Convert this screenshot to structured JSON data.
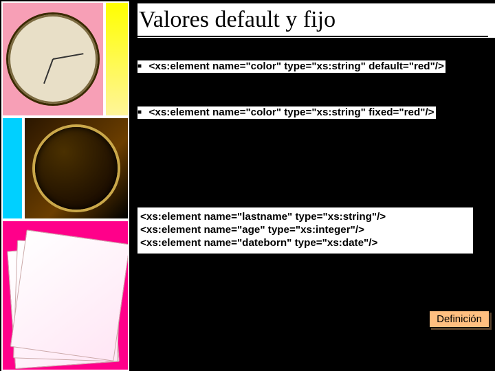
{
  "title": "Valores default y fijo",
  "code_line_default": "<xs:element name=\"color\" type=\"xs:string\" default=\"red\"/>",
  "code_line_fixed": "<xs:element name=\"color\" type=\"xs:string\" fixed=\"red\"/>",
  "code_block": {
    "line1": "<xs:element name=\"lastname\" type=\"xs:string\"/>",
    "line2": "<xs:element name=\"age\" type=\"xs:integer\"/>",
    "line3": "<xs:element name=\"dateborn\" type=\"xs:date\"/>"
  },
  "button_label": "Definición"
}
